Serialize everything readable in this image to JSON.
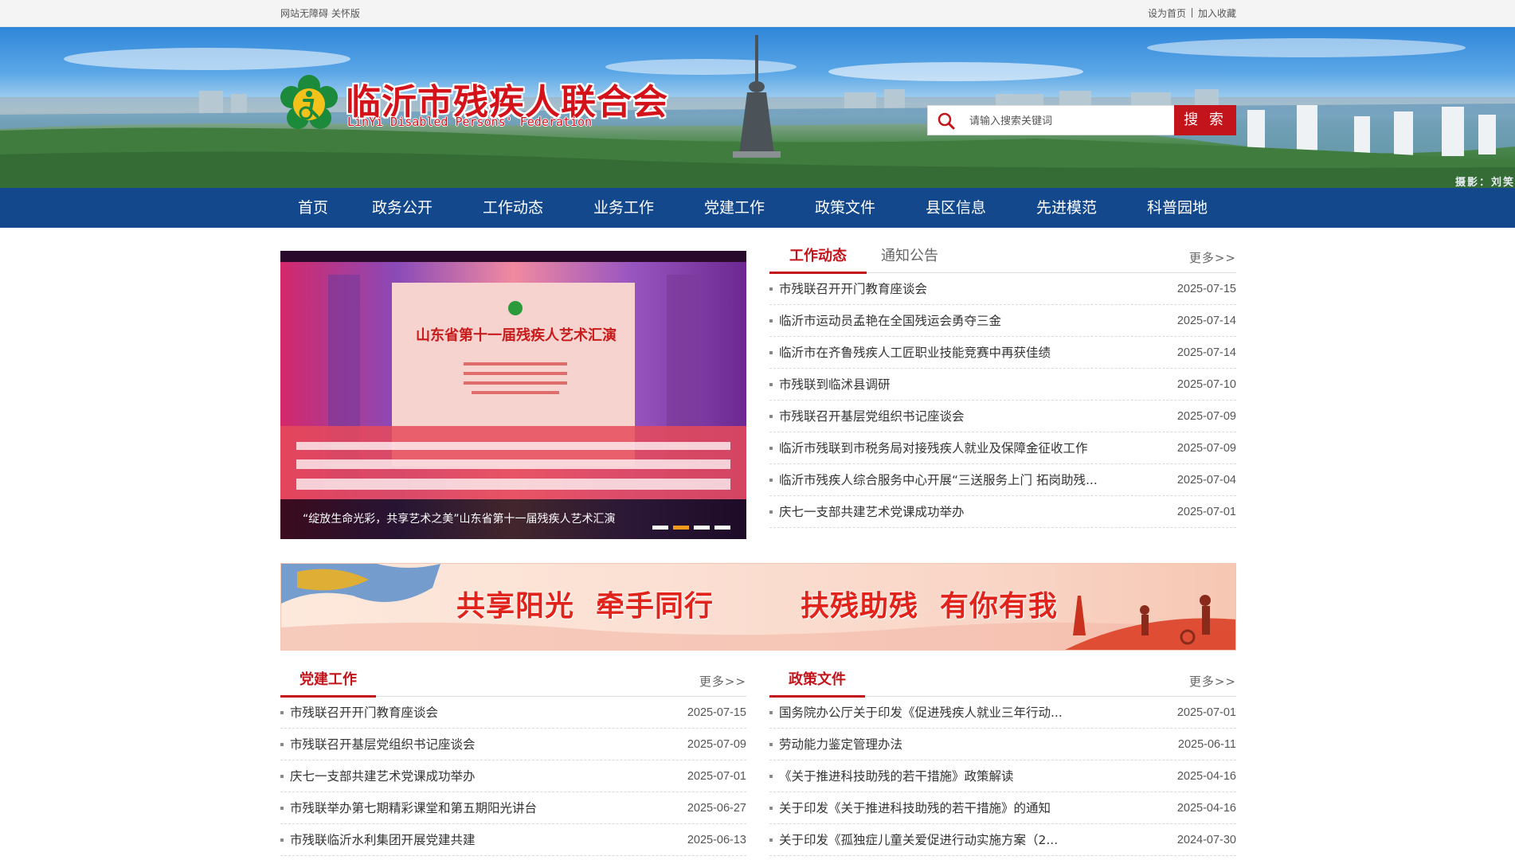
{
  "topbar": {
    "accessibility": "网站无障碍",
    "elder_mode": "关怀版",
    "set_homepage": "设为首页",
    "add_favorite": "加入收藏"
  },
  "header": {
    "title": "临沂市残疾人联合会",
    "subtitle": "LinYi Disabled Persons' Federation",
    "search_placeholder": "请输入搜索关键词",
    "search_button": "搜 索",
    "photo_credit": "摄影：刘笑"
  },
  "nav": {
    "items": [
      "首页",
      "政务公开",
      "工作动态",
      "业务工作",
      "党建工作",
      "政策文件",
      "县区信息",
      "先进模范",
      "科普园地"
    ]
  },
  "carousel": {
    "stage_text": "山东省第十一届残疾人艺术汇演",
    "caption": "“绽放生命光彩，共享艺术之美”山东省第十一届残疾人艺术汇演",
    "active_index": 1,
    "count": 4
  },
  "news": {
    "tabs": [
      "工作动态",
      "通知公告"
    ],
    "more": "更多>>",
    "items": [
      {
        "title": "市残联召开开门教育座谈会",
        "date": "2025-07-15"
      },
      {
        "title": "临沂市运动员孟艳在全国残运会勇夺三金",
        "date": "2025-07-14"
      },
      {
        "title": "临沂市在齐鲁残疾人工匠职业技能竞赛中再获佳绩",
        "date": "2025-07-14"
      },
      {
        "title": "市残联到临沭县调研",
        "date": "2025-07-10"
      },
      {
        "title": "市残联召开基层党组织书记座谈会",
        "date": "2025-07-09"
      },
      {
        "title": "临沂市残联到市税务局对接残疾人就业及保障金征收工作",
        "date": "2025-07-09"
      },
      {
        "title": "临沂市残疾人综合服务中心开展“三送服务上门 拓岗助残...",
        "date": "2025-07-04"
      },
      {
        "title": "庆七一支部共建艺术党课成功举办",
        "date": "2025-07-01"
      }
    ]
  },
  "slogan": {
    "part1": "共享阳光",
    "part2": "牵手同行",
    "part3": "扶残助残",
    "part4": "有你有我"
  },
  "party": {
    "title": "党建工作",
    "more": "更多>>",
    "items": [
      {
        "title": "市残联召开开门教育座谈会",
        "date": "2025-07-15"
      },
      {
        "title": "市残联召开基层党组织书记座谈会",
        "date": "2025-07-09"
      },
      {
        "title": "庆七一支部共建艺术党课成功举办",
        "date": "2025-07-01"
      },
      {
        "title": "市残联举办第七期精彩课堂和第五期阳光讲台",
        "date": "2025-06-27"
      },
      {
        "title": "市残联临沂水利集团开展党建共建",
        "date": "2025-06-13"
      }
    ]
  },
  "policy": {
    "title": "政策文件",
    "more": "更多>>",
    "items": [
      {
        "title": "国务院办公厅关于印发《促进残疾人就业三年行动...",
        "date": "2025-07-01"
      },
      {
        "title": "劳动能力鉴定管理办法",
        "date": "2025-06-11"
      },
      {
        "title": "《关于推进科技助残的若干措施》政策解读",
        "date": "2025-04-16"
      },
      {
        "title": "关于印发《关于推进科技助残的若干措施》的通知",
        "date": "2025-04-16"
      },
      {
        "title": "关于印发《孤独症儿童关爱促进行动实施方案（2...",
        "date": "2024-07-30"
      }
    ]
  },
  "colors": {
    "nav_bg": "#13488c",
    "accent_red": "#c3141b",
    "dot_active": "#f19a1b"
  }
}
